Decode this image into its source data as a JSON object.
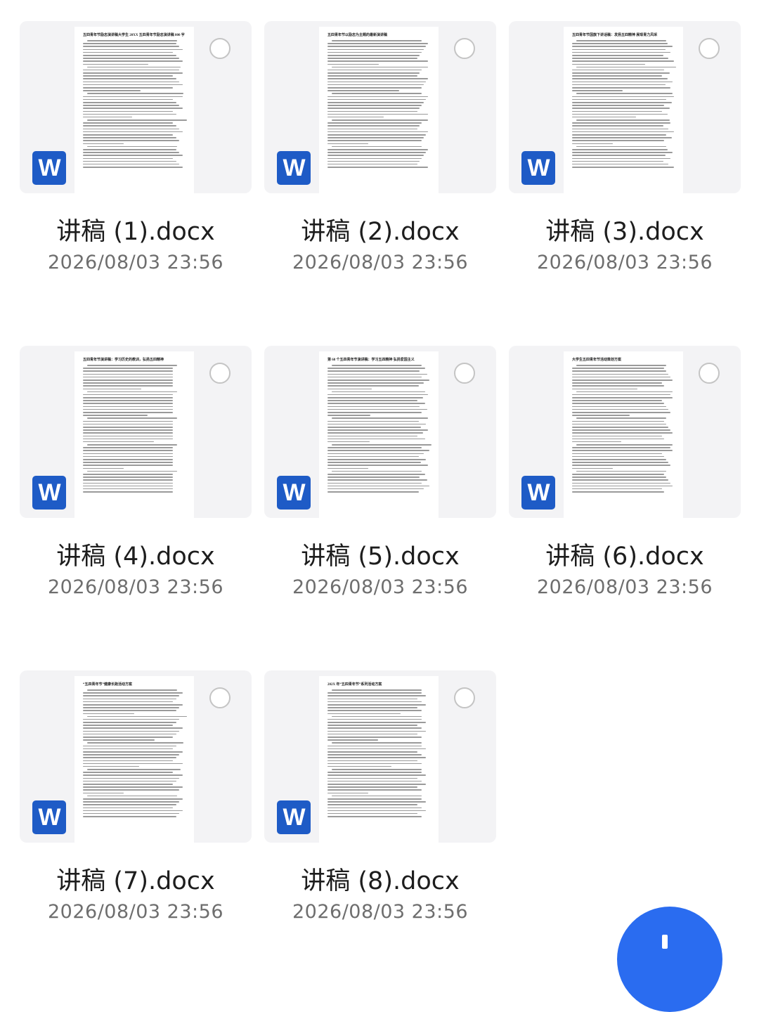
{
  "colors": {
    "background": "#ffffff",
    "thumbnail_bg": "#f3f3f5",
    "word_icon": "#1e5bc6",
    "fab": "#2a6cf0",
    "name_text": "#1d1d1d",
    "date_text": "#6e6e6e"
  },
  "files": [
    {
      "name": "讲稿 (1).docx",
      "date": "2026/08/03 23:56",
      "icon": "word-icon",
      "icon_letter": "W",
      "preview_title": "五四青年节励志演讲稿大学生 20XX 五四青年节励志演讲稿 800 字"
    },
    {
      "name": "讲稿 (2).docx",
      "date": "2026/08/03 23:56",
      "icon": "word-icon",
      "icon_letter": "W",
      "preview_title": "五四青年节以励志为主题的最新演讲稿"
    },
    {
      "name": "讲稿 (3).docx",
      "date": "2026/08/03 23:56",
      "icon": "word-icon",
      "icon_letter": "W",
      "preview_title": "五四青年节国旗下讲话稿：发扬五四精神 展现青力风采"
    },
    {
      "name": "讲稿 (4).docx",
      "date": "2026/08/03 23:56",
      "icon": "word-icon",
      "icon_letter": "W",
      "preview_title": "五四青年节演讲稿：学习历史的教训，弘扬五四精神"
    },
    {
      "name": "讲稿 (5).docx",
      "date": "2026/08/03 23:56",
      "icon": "word-icon",
      "icon_letter": "W",
      "preview_title": "第 68 个五四青年节演讲稿：学习五四精神 弘扬爱国主义"
    },
    {
      "name": "讲稿 (6).docx",
      "date": "2026/08/03 23:56",
      "icon": "word-icon",
      "icon_letter": "W",
      "preview_title": "大学生五四青年节活动策划方案"
    },
    {
      "name": "讲稿 (7).docx",
      "date": "2026/08/03 23:56",
      "icon": "word-icon",
      "icon_letter": "W",
      "preview_title": "“五四青年节”健康长跑活动方案"
    },
    {
      "name": "讲稿 (8).docx",
      "date": "2026/08/03 23:56",
      "icon": "word-icon",
      "icon_letter": "W",
      "preview_title": "202X 年“五四青年节”系列活动方案"
    }
  ],
  "fab": {
    "icon": "plus-icon"
  }
}
